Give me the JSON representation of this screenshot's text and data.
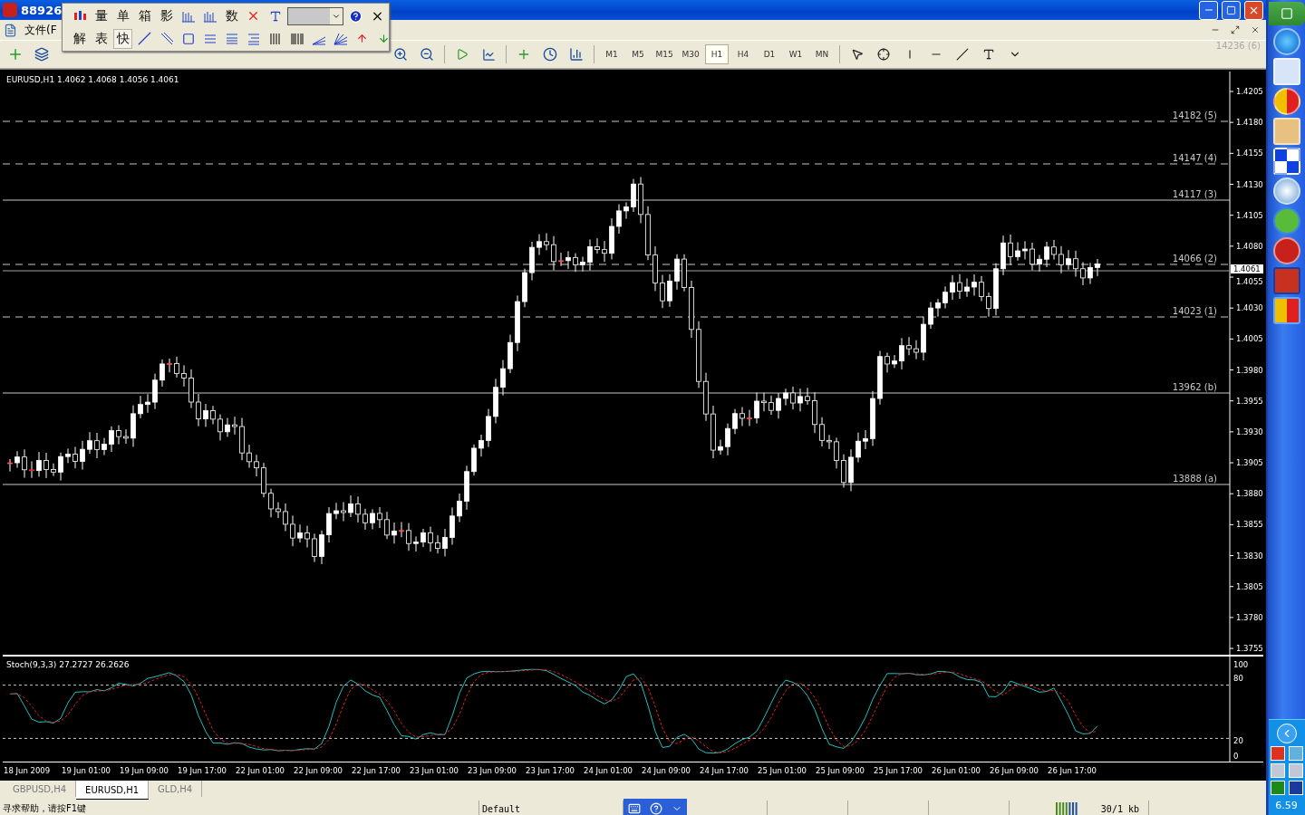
{
  "window": {
    "title": "88926"
  },
  "menu": [
    {
      "label": "文件(F"
    }
  ],
  "floating_toolbar": {
    "row_1": [
      {
        "label": "量"
      },
      {
        "label": "单"
      },
      {
        "label": "箱"
      },
      {
        "label": "影"
      },
      {
        "label": "数"
      }
    ],
    "row_2": [
      {
        "label": "解",
        "selected": false
      },
      {
        "label": "表",
        "selected": false
      },
      {
        "label": "快",
        "selected": true
      }
    ]
  },
  "toolbar": {
    "ghost_label": "14236 (6)",
    "timeframes": [
      {
        "label": "M1",
        "selected": false
      },
      {
        "label": "M5",
        "selected": false
      },
      {
        "label": "M15",
        "selected": false
      },
      {
        "label": "M30",
        "selected": false
      },
      {
        "label": "H1",
        "selected": true
      },
      {
        "label": "H4",
        "selected": false
      },
      {
        "label": "D1",
        "selected": false
      },
      {
        "label": "W1",
        "selected": false
      },
      {
        "label": "MN",
        "selected": false
      }
    ]
  },
  "chart": {
    "info": "EURUSD,H1  1.4062 1.4068 1.4056 1.4061",
    "price_ticks": [
      "1.4205",
      "1.4180",
      "1.4155",
      "1.4130",
      "1.4105",
      "1.4080",
      "1.4055",
      "1.4030",
      "1.4005",
      "1.3980",
      "1.3955",
      "1.3930",
      "1.3905",
      "1.3880",
      "1.3855",
      "1.3830",
      "1.3805",
      "1.3780",
      "1.3755"
    ],
    "current_price": "1.4061",
    "levels": [
      {
        "label": "14182 (5)"
      },
      {
        "label": "14147 (4)"
      },
      {
        "label": "14117 (3)"
      },
      {
        "label": "14066 (2)"
      },
      {
        "label": "14023 (1)"
      },
      {
        "label": "13962 (b)"
      },
      {
        "label": "13888 (a)"
      }
    ],
    "stoch": {
      "label": "Stoch(9,3,3) 27.2727 26.2626",
      "ticks": [
        "100",
        "80",
        "20",
        "0"
      ]
    },
    "time_labels": [
      "18 Jun 2009",
      "19 Jun 01:00",
      "19 Jun 09:00",
      "19 Jun 17:00",
      "22 Jun 01:00",
      "22 Jun 09:00",
      "22 Jun 17:00",
      "23 Jun 01:00",
      "23 Jun 09:00",
      "23 Jun 17:00",
      "24 Jun 01:00",
      "24 Jun 09:00",
      "24 Jun 17:00",
      "25 Jun 01:00",
      "25 Jun 09:00",
      "25 Jun 17:00",
      "26 Jun 01:00",
      "26 Jun 09:00",
      "26 Jun 17:00"
    ]
  },
  "tabs": [
    {
      "label": "GBPUSD,H4",
      "selected": false
    },
    {
      "label": "EURUSD,H1",
      "selected": true
    },
    {
      "label": "GLD,H4",
      "selected": false
    }
  ],
  "status_bar": {
    "help": "寻求帮助，请按F1键",
    "profile": "Default",
    "traffic": "30/1 kb"
  },
  "taskbar": {
    "clock": "6.59"
  }
}
